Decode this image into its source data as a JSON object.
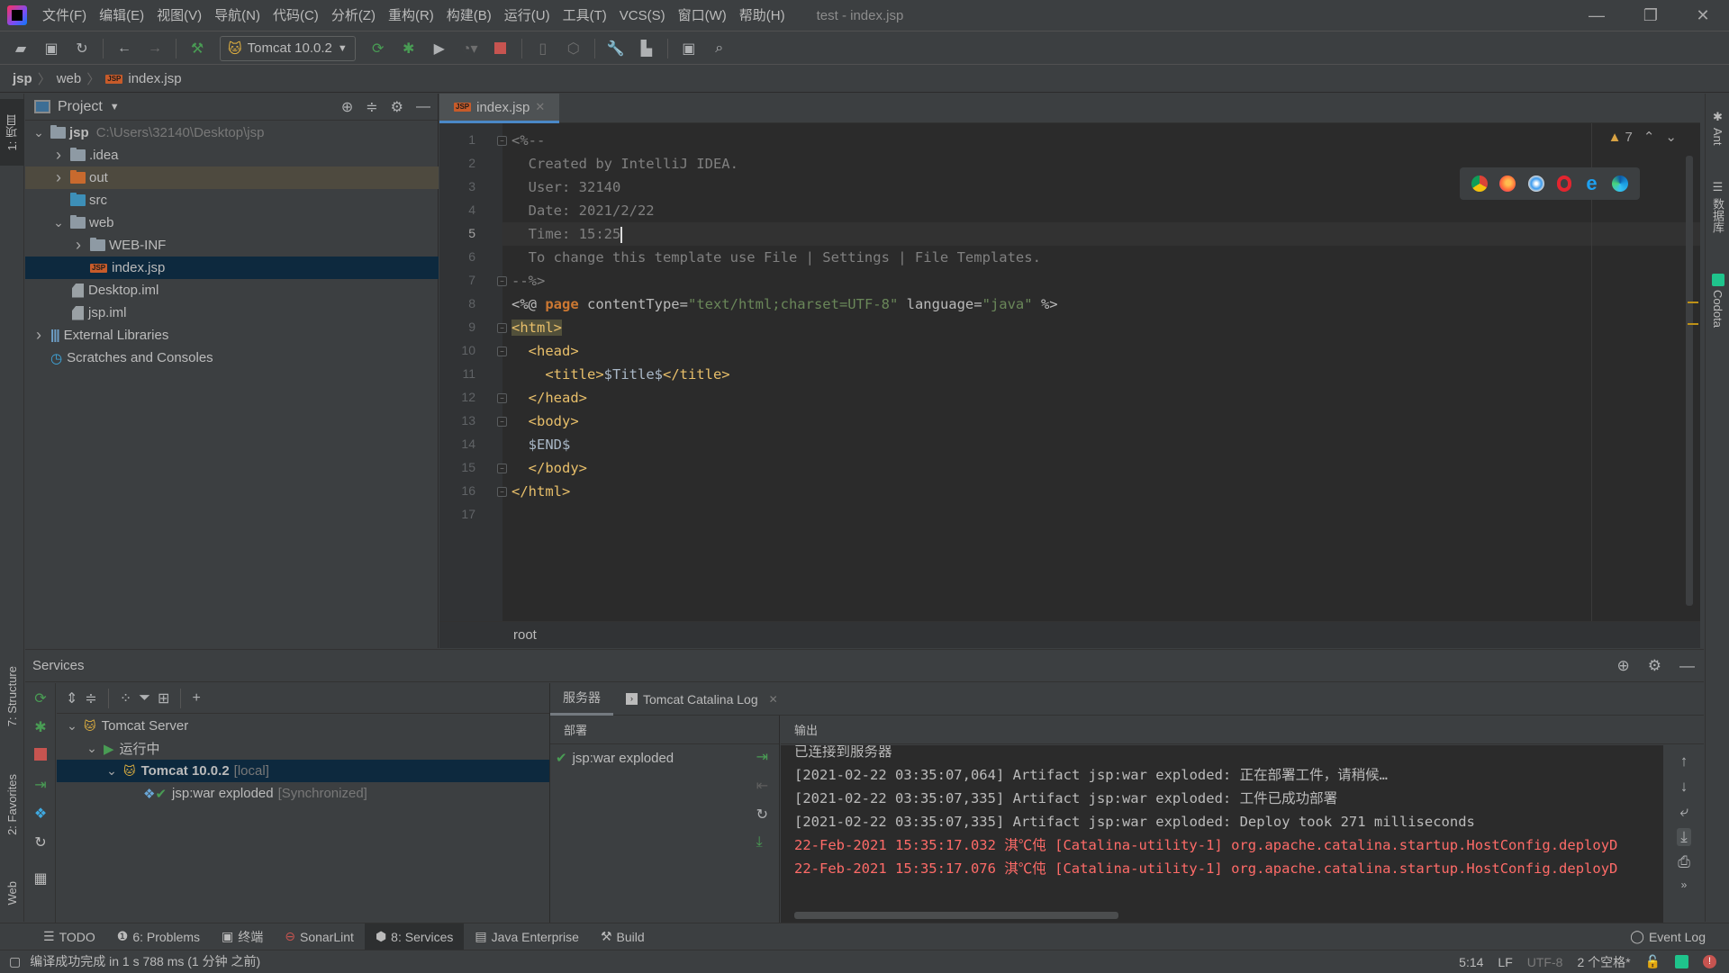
{
  "window": {
    "title": "test - index.jsp",
    "menu": [
      "文件(F)",
      "编辑(E)",
      "视图(V)",
      "导航(N)",
      "代码(C)",
      "分析(Z)",
      "重构(R)",
      "构建(B)",
      "运行(U)",
      "工具(T)",
      "VCS(S)",
      "窗口(W)",
      "帮助(H)"
    ],
    "controls": {
      "minimize": "—",
      "restore": "❐",
      "close": "✕"
    }
  },
  "toolbar": {
    "run_config": "Tomcat 10.0.2",
    "icons": [
      "open-folder-icon",
      "save-icon",
      "sync-icon",
      "back-icon",
      "forward-icon",
      "build-hammer-icon",
      "rerun-icon",
      "debug-icon",
      "run-with-coverage-icon",
      "profile-icon",
      "stop-icon",
      "attach-device-icon",
      "deploy-icon",
      "settings-wrench-icon",
      "project-structure-icon",
      "terminal-frame-icon",
      "search-icon"
    ]
  },
  "breadcrumb": [
    "jsp",
    "web",
    "index.jsp"
  ],
  "left_stripe": {
    "project_tab": "1: 项目",
    "structure_tab": "7: Structure",
    "favorites_tab": "2: Favorites",
    "web_tab": "Web"
  },
  "right_stripe": {
    "ant": "Ant",
    "database": "数据库",
    "codota": "Codota"
  },
  "project": {
    "title": "Project",
    "tree": [
      {
        "label": "jsp",
        "extra": "C:\\Users\\32140\\Desktop\\jsp",
        "depth": 0,
        "expanded": true,
        "type": "module"
      },
      {
        "label": ".idea",
        "depth": 1,
        "expanded": false,
        "type": "folder"
      },
      {
        "label": "out",
        "depth": 1,
        "expanded": false,
        "type": "folder-excluded"
      },
      {
        "label": "src",
        "depth": 1,
        "type": "folder-source"
      },
      {
        "label": "web",
        "depth": 1,
        "expanded": true,
        "type": "folder-web"
      },
      {
        "label": "WEB-INF",
        "depth": 2,
        "expanded": false,
        "type": "folder"
      },
      {
        "label": "index.jsp",
        "depth": 2,
        "type": "jsp",
        "selected": true
      },
      {
        "label": "Desktop.iml",
        "depth": 1,
        "type": "iml"
      },
      {
        "label": "jsp.iml",
        "depth": 1,
        "type": "iml"
      },
      {
        "label": "External Libraries",
        "depth": 0,
        "expanded": false,
        "type": "libraries"
      },
      {
        "label": "Scratches and Consoles",
        "depth": 0,
        "type": "scratches"
      }
    ]
  },
  "editor": {
    "tab": "index.jsp",
    "warnings": "7",
    "breadcrumb_footer": "root",
    "browsers": [
      "chrome-icon",
      "firefox-icon",
      "safari-icon",
      "opera-icon",
      "ie-icon",
      "edge-icon"
    ],
    "current_line": 5,
    "lines": [
      "<%--",
      "  Created by IntelliJ IDEA.",
      "  User: 32140",
      "  Date: 2021/2/22",
      "  Time: 15:25",
      "  To change this template use File | Settings | File Templates.",
      "--%>",
      "<%@ page contentType=\"text/html;charset=UTF-8\" language=\"java\" %>",
      "<html>",
      "  <head>",
      "    <title>$Title$</title>",
      "  </head>",
      "  <body>",
      "  $END$",
      "  </body>",
      "</html>",
      ""
    ]
  },
  "services": {
    "title": "Services",
    "tree": [
      {
        "label": "Tomcat Server",
        "depth": 0
      },
      {
        "label": "运行中",
        "depth": 1
      },
      {
        "label": "Tomcat 10.0.2",
        "suffix": "[local]",
        "depth": 2,
        "selected": true
      },
      {
        "label": "jsp:war exploded",
        "suffix": "[Synchronized]",
        "depth": 3
      }
    ],
    "detail_tabs": [
      "服务器",
      "Tomcat Catalina Log"
    ],
    "deploy_header": "部署",
    "output_header": "输出",
    "deployments": [
      "jsp:war exploded"
    ],
    "console": [
      {
        "text": "已连接到服务器",
        "error": false
      },
      {
        "text": "[2021-02-22 03:35:07,064] Artifact jsp:war exploded: 正在部署工件，请稍候…",
        "error": false
      },
      {
        "text": "[2021-02-22 03:35:07,335] Artifact jsp:war exploded: 工件已成功部署",
        "error": false
      },
      {
        "text": "[2021-02-22 03:35:07,335] Artifact jsp:war exploded: Deploy took 271 milliseconds",
        "error": false
      },
      {
        "text": "22-Feb-2021 15:35:17.032 淇℃伅 [Catalina-utility-1] org.apache.catalina.startup.HostConfig.deployD",
        "error": true
      },
      {
        "text": "22-Feb-2021 15:35:17.076 淇℃伅 [Catalina-utility-1] org.apache.catalina.startup.HostConfig.deployD",
        "error": true
      }
    ]
  },
  "tool_tabs": [
    "TODO",
    "6: Problems",
    "终端",
    "SonarLint",
    "8: Services",
    "Java Enterprise",
    "Build"
  ],
  "event_log": "Event Log",
  "status": {
    "message": "编译成功完成 in 1 s 788 ms (1 分钟 之前)",
    "position": "5:14",
    "line_sep": "LF",
    "encoding": "UTF-8",
    "indent": "2 个空格*"
  },
  "colors": {
    "accent": "#4a88c7",
    "selection": "#0d293e",
    "error": "#ff6b68",
    "keyword": "#cc7832",
    "tag": "#e8bf6a",
    "string": "#6a8759",
    "run_green": "#499c54",
    "stop_red": "#c75450"
  }
}
